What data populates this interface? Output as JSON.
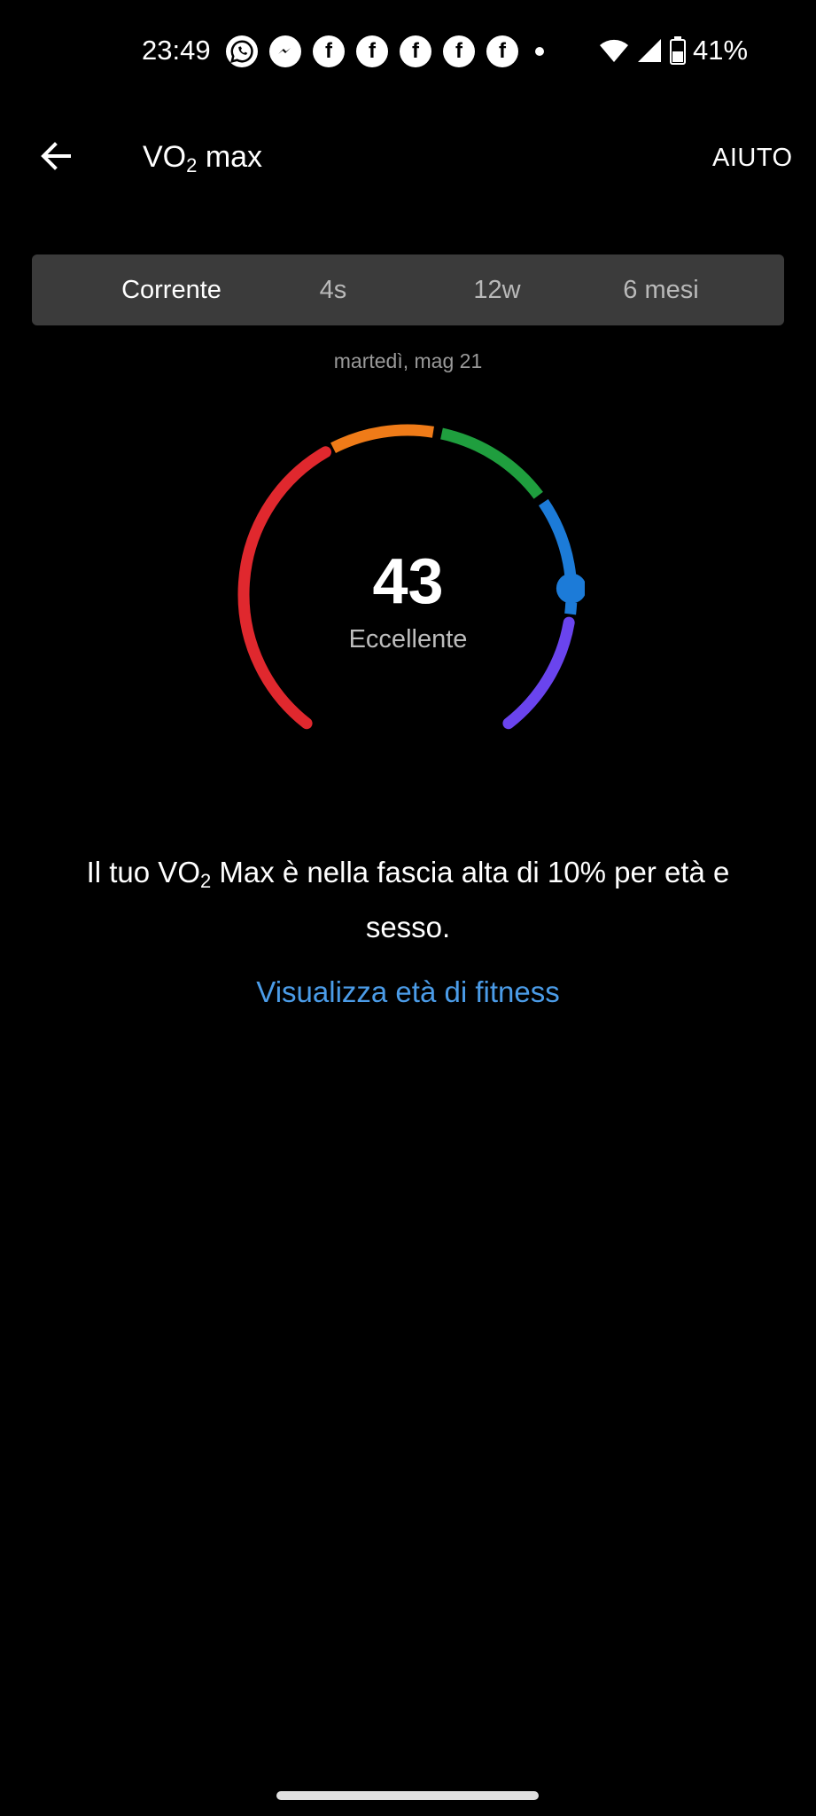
{
  "status_bar": {
    "time": "23:49",
    "battery": "41%",
    "notification_icons": [
      "whatsapp-icon",
      "messenger-icon",
      "facebook-icon",
      "facebook-icon",
      "facebook-icon",
      "facebook-icon",
      "facebook-icon",
      "more-dot-icon"
    ],
    "right_icons": [
      "wifi-icon",
      "signal-icon",
      "battery-icon"
    ]
  },
  "header": {
    "title_main": "VO",
    "title_sub": "2",
    "title_rest": " max",
    "help_label": "AIUTO"
  },
  "tabs": [
    {
      "label": "Corrente",
      "active": true
    },
    {
      "label": "4s",
      "active": false
    },
    {
      "label": "12w",
      "active": false
    },
    {
      "label": "6 mesi",
      "active": false
    }
  ],
  "date_label": "martedì, mag 21",
  "gauge": {
    "value": "43",
    "category": "Eccellente",
    "segment_colors": [
      "#e0282e",
      "#ef7b18",
      "#1f9e3e",
      "#1c7bd8",
      "#6a44ee"
    ],
    "indicator_color": "#1c7bd8"
  },
  "description": {
    "before": "Il tuo VO",
    "sub": "2",
    "after": " Max è nella fascia alta di 10% per età e sesso."
  },
  "link_label": "Visualizza età di fitness"
}
